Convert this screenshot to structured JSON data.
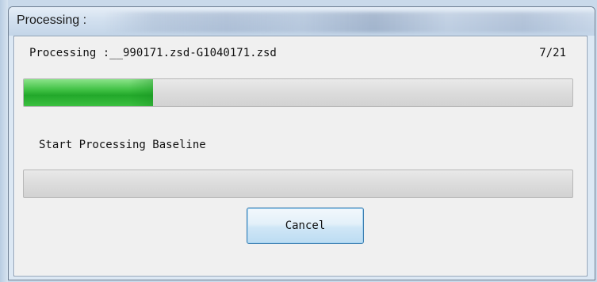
{
  "window": {
    "title": "Processing :"
  },
  "file_progress": {
    "label": "Processing :__990171.zsd-G1040171.zsd",
    "count": "7/21",
    "fraction": 0.235
  },
  "baseline_progress": {
    "label": "Start Processing Baseline",
    "fraction": 0
  },
  "buttons": {
    "cancel_label": "Cancel"
  },
  "colors": {
    "progress_fill": "#22a82a",
    "button_border": "#3c7fb1"
  }
}
